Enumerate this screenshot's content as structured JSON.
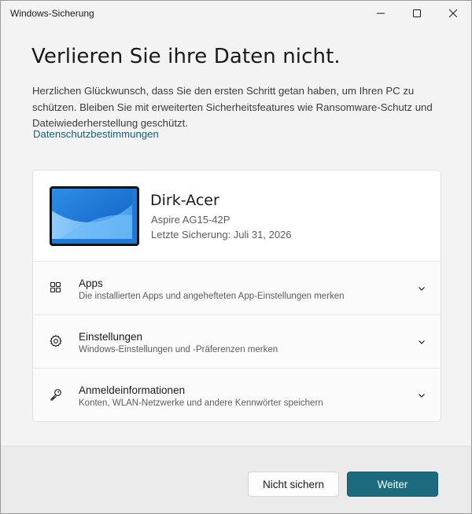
{
  "window": {
    "title": "Windows-Sicherung"
  },
  "main": {
    "heading": "Verlieren Sie ihre Daten nicht.",
    "description": "Herzlichen Glückwunsch, dass Sie den ersten Schritt getan haben, um Ihren PC zu schützen. Bleiben Sie mit erweiterten Sicherheitsfeatures wie Ransomware-Schutz und Dateiwiederherstellung geschützt.",
    "privacy_link": "Datenschutzbestimmungen"
  },
  "device": {
    "name": "Dirk-Acer",
    "model": "Aspire AG15-42P",
    "last_backup": "Letzte Sicherung: Juli 31, 2026"
  },
  "sections": [
    {
      "title": "Apps",
      "subtitle": "Die installierten Apps und angehefteten App-Einstellungen merken",
      "icon": "apps-icon"
    },
    {
      "title": "Einstellungen",
      "subtitle": "Windows-Einstellungen und -Präferenzen merken",
      "icon": "gear-icon"
    },
    {
      "title": "Anmeldeinformationen",
      "subtitle": "Konten, WLAN-Netzwerke und andere Kennwörter speichern",
      "icon": "key-icon"
    }
  ],
  "footer": {
    "secondary_label": "Nicht sichern",
    "primary_label": "Weiter"
  },
  "colors": {
    "accent": "#1b6a7d",
    "link": "#1a5f70",
    "background": "#f3f3f3"
  }
}
